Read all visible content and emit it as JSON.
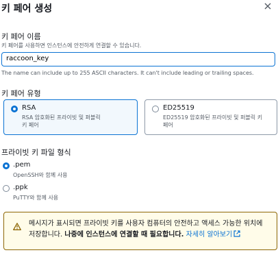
{
  "dialog": {
    "title": "키 페어 생성"
  },
  "name_field": {
    "label": "키 페어 이름",
    "description": "키 페어를 사용하면 인스턴스에 안전하게 연결할 수 있습니다.",
    "value": "raccoon_key",
    "constraint": "The name can include up to 255 ASCII characters. It can't include leading or trailing spaces."
  },
  "key_type": {
    "label": "키 페어 유형",
    "options": [
      {
        "title": "RSA",
        "description": "RSA 암호화된 프라이빗 및 퍼블릭 키 페어",
        "selected": true
      },
      {
        "title": "ED25519",
        "description": "ED25519 암호화된 프라이빗 및 퍼블릭 키 페어",
        "selected": false
      }
    ]
  },
  "file_format": {
    "label": "프라이빗 키 파일 형식",
    "options": [
      {
        "title": ".pem",
        "description": "OpenSSH와 함께 사용",
        "selected": true
      },
      {
        "title": ".ppk",
        "description": "PuTTY와 함께 사용",
        "selected": false
      }
    ]
  },
  "alert": {
    "text_part1": "메시지가 표시되면 프라이빗 키를 사용자 컴퓨터의 안전하고 액세스 가능한 위치에 저장합니다. ",
    "text_bold": "나중에 인스턴스에 연결할 때 필요합니다.",
    "link": "자세히 알아보기"
  },
  "colors": {
    "accent": "#0972d3",
    "warning_bg": "#fffce9",
    "warning_border": "#8d6605"
  },
  "icons": [
    "close-icon",
    "warning-icon",
    "external-link-icon"
  ]
}
